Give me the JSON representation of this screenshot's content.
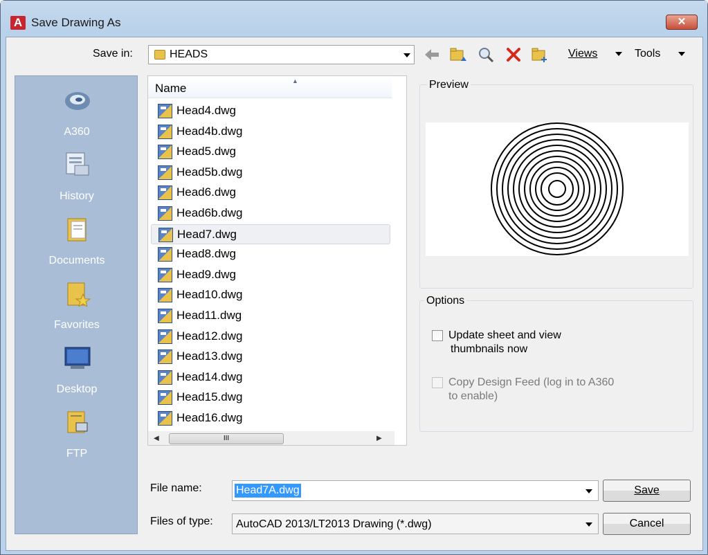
{
  "window": {
    "title": "Save Drawing As",
    "close_label": "✕",
    "app_letter": "A"
  },
  "toolbar": {
    "save_in_label": "Save in:",
    "save_in_value": "HEADS",
    "views_label": "Views",
    "tools_label": "Tools"
  },
  "places": [
    {
      "label": "A360",
      "icon": "a360-cloud-icon"
    },
    {
      "label": "History",
      "icon": "history-icon"
    },
    {
      "label": "Documents",
      "icon": "documents-folder-icon"
    },
    {
      "label": "Favorites",
      "icon": "favorites-folder-icon"
    },
    {
      "label": "Desktop",
      "icon": "desktop-monitor-icon"
    },
    {
      "label": "FTP",
      "icon": "ftp-icon"
    }
  ],
  "file_list": {
    "column_name": "Name",
    "scroll_glyph": "III",
    "files": [
      "Head4.dwg",
      "Head4b.dwg",
      "Head5.dwg",
      "Head5b.dwg",
      "Head6.dwg",
      "Head6b.dwg",
      "Head7.dwg",
      "Head8.dwg",
      "Head9.dwg",
      "Head10.dwg",
      "Head11.dwg",
      "Head12.dwg",
      "Head13.dwg",
      "Head14.dwg",
      "Head15.dwg",
      "Head16.dwg"
    ],
    "selected": "Head7.dwg"
  },
  "preview": {
    "label": "Preview"
  },
  "options": {
    "label": "Options",
    "update_line1": "Update sheet and view",
    "update_line2": "thumbnails now",
    "copy_line1": "Copy Design Feed (log in to A360",
    "copy_line2": "to enable)"
  },
  "bottom": {
    "file_name_label": "File name:",
    "file_name_value": "Head7A.dwg",
    "files_of_type_label": "Files of type:",
    "files_of_type_value": "AutoCAD 2013/LT2013 Drawing (*.dwg)",
    "save_button": "Save",
    "cancel_button": "Cancel"
  },
  "colors": {
    "title_bg": "#b9d1ea",
    "places_bg": "#a9bed6",
    "close_red": "#c7503a",
    "selection_blue": "#3399ff"
  }
}
